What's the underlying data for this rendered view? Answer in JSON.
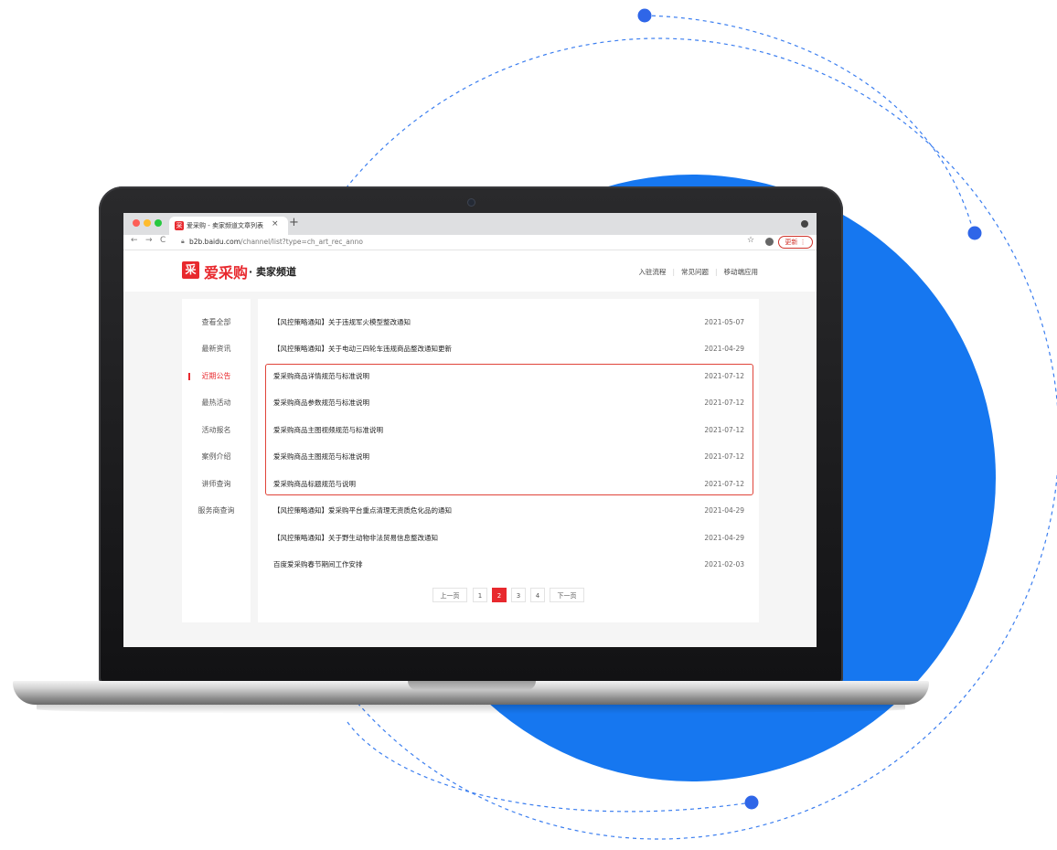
{
  "colors": {
    "brand_red": "#e8292e",
    "circle_blue": "#1677f0",
    "dot_blue": "#2f66e8"
  },
  "browser": {
    "tab_title": "爱采购 - 卖家频道文章列表",
    "tab_close": "×",
    "new_tab": "+",
    "url_host": "b2b.baidu.com",
    "url_path": "/channel/list?type=ch_art_rec_anno",
    "update_button": "更新 ⋮"
  },
  "site": {
    "logo_mark": "采",
    "logo_text": "爱采购",
    "logo_sub": "· 卖家频道",
    "top_links": [
      "入驻流程",
      "常见问题",
      "移动端应用"
    ]
  },
  "sidebar": {
    "items": [
      {
        "label": "查看全部",
        "active": false
      },
      {
        "label": "最新资讯",
        "active": false
      },
      {
        "label": "近期公告",
        "active": true
      },
      {
        "label": "最热活动",
        "active": false
      },
      {
        "label": "活动报名",
        "active": false
      },
      {
        "label": "案例介绍",
        "active": false
      },
      {
        "label": "讲师查询",
        "active": false
      },
      {
        "label": "服务商查询",
        "active": false
      }
    ]
  },
  "articles": [
    {
      "title": "【风控策略通知】关于违规军火模型整改通知",
      "date": "2021-05-07"
    },
    {
      "title": "【风控策略通知】关于电动三四轮车违规商品整改通知更新",
      "date": "2021-04-29"
    },
    {
      "title": "爱采购商品详情规范与标准说明",
      "date": "2021-07-12"
    },
    {
      "title": "爱采购商品参数规范与标准说明",
      "date": "2021-07-12"
    },
    {
      "title": "爱采购商品主图视频规范与标准说明",
      "date": "2021-07-12"
    },
    {
      "title": "爱采购商品主图规范与标准说明",
      "date": "2021-07-12"
    },
    {
      "title": "爱采购商品标题规范与说明",
      "date": "2021-07-12"
    },
    {
      "title": "【风控策略通知】爱采购平台重点清理无资质危化品的通知",
      "date": "2021-04-29"
    },
    {
      "title": "【风控策略通知】关于野生动物非法贸易信息整改通知",
      "date": "2021-04-29"
    },
    {
      "title": "百度爱采购春节期间工作安排",
      "date": "2021-02-03"
    }
  ],
  "pagination": {
    "prev": "上一页",
    "pages": [
      "1",
      "2",
      "3",
      "4"
    ],
    "current": "2",
    "next": "下一页"
  }
}
